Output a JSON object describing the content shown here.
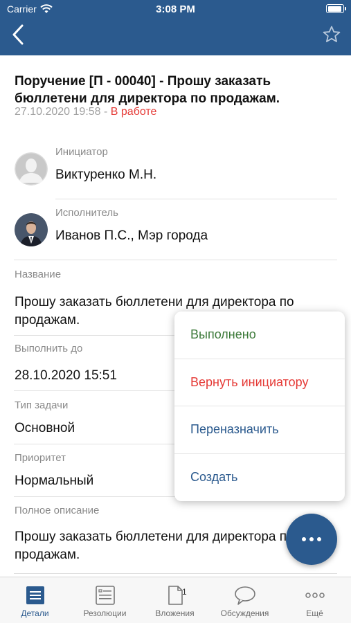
{
  "status_bar": {
    "carrier": "Carrier",
    "time": "3:08 PM"
  },
  "task": {
    "title": "Поручение [П - 00040] - Прошу заказать бюллетени для директора по продажам.",
    "datetime": "27.10.2020 19:58",
    "separator": " - ",
    "status": "В работе"
  },
  "initiator": {
    "label": "Инициатор",
    "name": "Виктуренко М.Н."
  },
  "executor": {
    "label": "Исполнитель",
    "name": "Иванов П.С., Мэр города"
  },
  "fields": {
    "name_label": "Название",
    "name_value": "Прошу заказать бюллетени для директора по продажам.",
    "due_label": "Выполнить до",
    "due_value": "28.10.2020 15:51",
    "type_label": "Тип задачи",
    "type_value": "Основной",
    "priority_label": "Приоритет",
    "priority_value": "Нормальный",
    "description_label": "Полное описание",
    "description_value": "Прошу заказать бюллетени для директора по продажам."
  },
  "action_menu": {
    "items": [
      {
        "label": "Выполнено",
        "color": "#3d7a3a"
      },
      {
        "label": "Вернуть инициатору",
        "color": "#e53935"
      },
      {
        "label": "Переназначить",
        "color": "#2b5a8e"
      },
      {
        "label": "Создать",
        "color": "#2b5a8e"
      }
    ]
  },
  "tabs": [
    {
      "label": "Детали",
      "icon": "details-icon",
      "active": true
    },
    {
      "label": "Резолюции",
      "icon": "resolutions-icon"
    },
    {
      "label": "Вложения",
      "icon": "attachments-icon",
      "badge": "1"
    },
    {
      "label": "Обсуждения",
      "icon": "discussions-icon"
    },
    {
      "label": "Ещё",
      "icon": "more-icon"
    }
  ],
  "colors": {
    "primary": "#2b5a8e",
    "status_red": "#e53935",
    "done_green": "#3d7a3a"
  }
}
